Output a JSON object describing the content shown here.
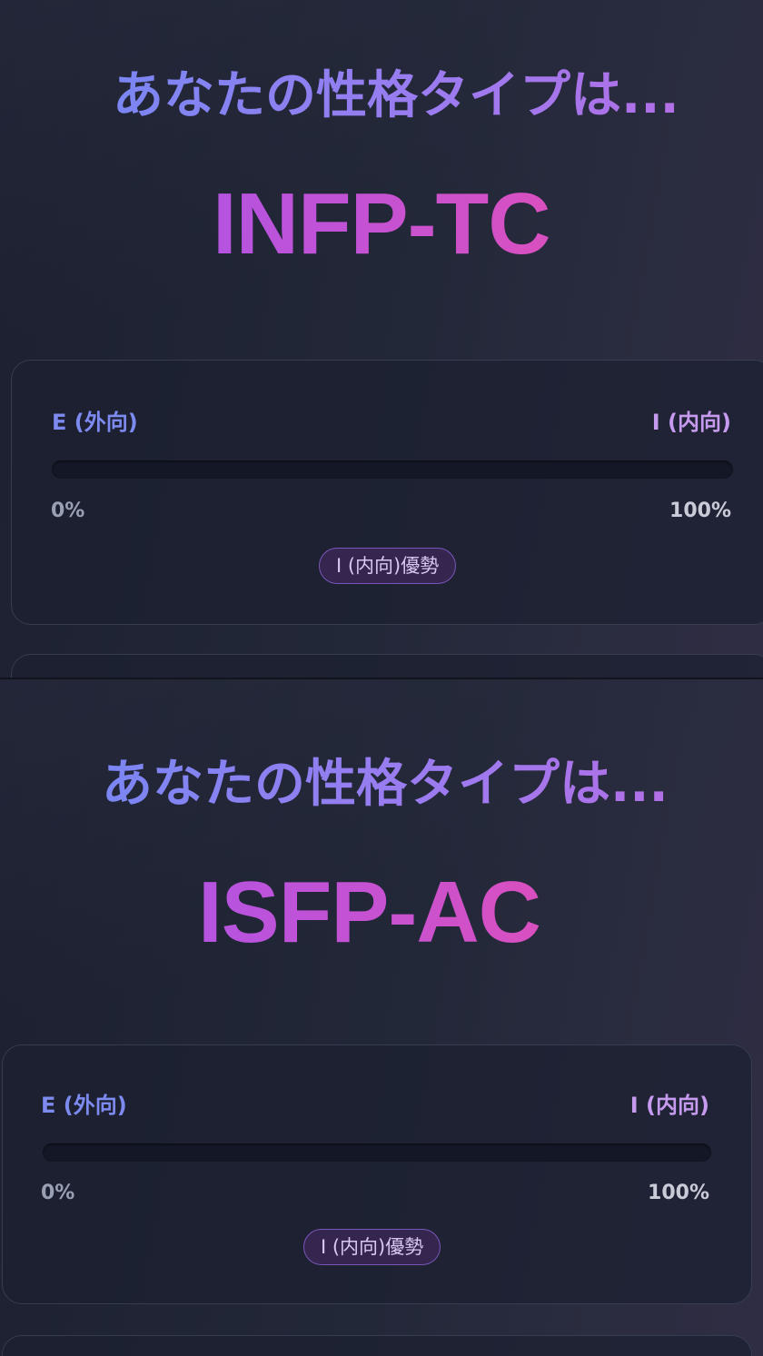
{
  "results": [
    {
      "heading": "あなたの性格タイプは...",
      "type_code": "INFP-TC",
      "axis": {
        "left_label": "E (外向)",
        "right_label": "I (内向)",
        "left_percent": "0%",
        "right_percent": "100%",
        "fill_fraction_toward_left": 0.0,
        "dominant_badge": "I (内向)優勢"
      }
    },
    {
      "heading": "あなたの性格タイプは...",
      "type_code": "ISFP-AC",
      "axis": {
        "left_label": "E (外向)",
        "right_label": "I (内向)",
        "left_percent": "0%",
        "right_percent": "100%",
        "fill_fraction_toward_left": 0.0,
        "dominant_badge": "I (内向)優勢"
      }
    }
  ],
  "colors": {
    "background": "#1b1f2e",
    "heading_gradient_start": "#7b86f2",
    "heading_gradient_end": "#b26fe6",
    "type_gradient_start": "#b553e0",
    "type_gradient_end": "#d94fbf",
    "left_label": "#7d8af0",
    "right_label": "#c69aee",
    "badge_border": "#7a55b8",
    "badge_fill": "#34264f"
  }
}
